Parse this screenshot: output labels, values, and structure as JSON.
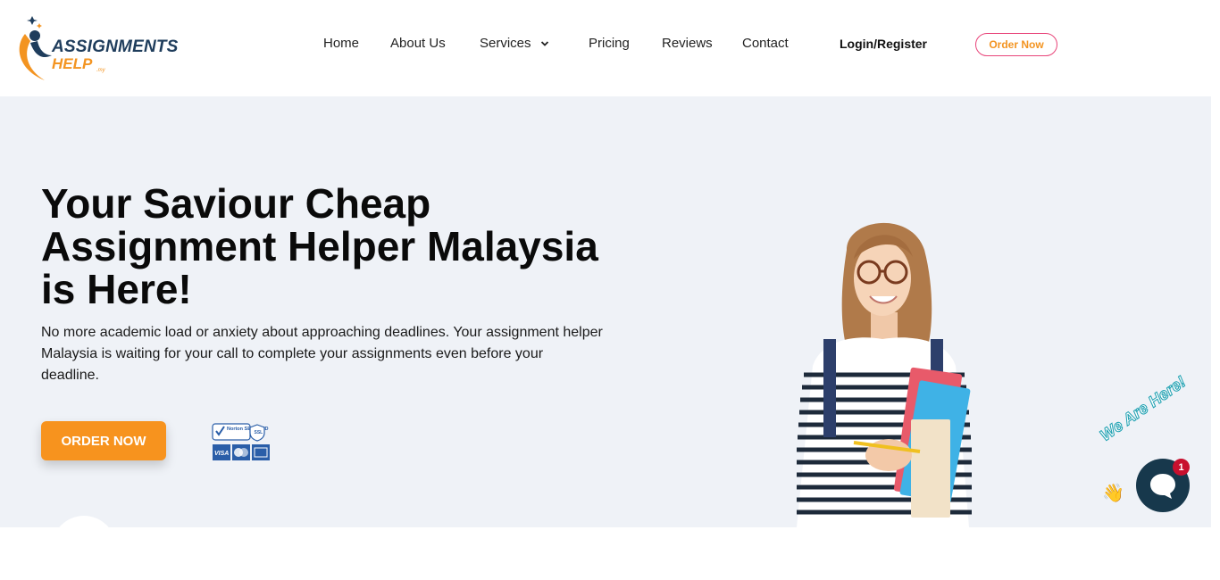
{
  "logo": {
    "line1": "ASSIGNMENTS",
    "line2": "HELP",
    "suffix": ".my"
  },
  "nav": {
    "items": [
      {
        "label": "Home"
      },
      {
        "label": "About Us"
      },
      {
        "label": "Services"
      },
      {
        "label": "Pricing"
      },
      {
        "label": "Reviews"
      },
      {
        "label": "Contact"
      }
    ],
    "login": "Login/Register",
    "order": "Order Now"
  },
  "hero": {
    "title": "Your Saviour Cheap Assignment Helper Malaysia is Here!",
    "description": "No more academic load or anxiety about approaching deadlines. Your assignment helper Malaysia is waiting for your call to complete your assignments even before your deadline.",
    "cta": "ORDER NOW"
  },
  "badges": {
    "norton": "Norton SECURED",
    "visa": "VISA"
  },
  "chat": {
    "tagline": "We Are Here!",
    "unread": "1"
  },
  "colors": {
    "accent": "#f7931e",
    "brand_dark": "#1f3d5c",
    "hero_bg": "#eff2f7",
    "order_border": "#e8457a",
    "chat_bg": "#17384c"
  }
}
